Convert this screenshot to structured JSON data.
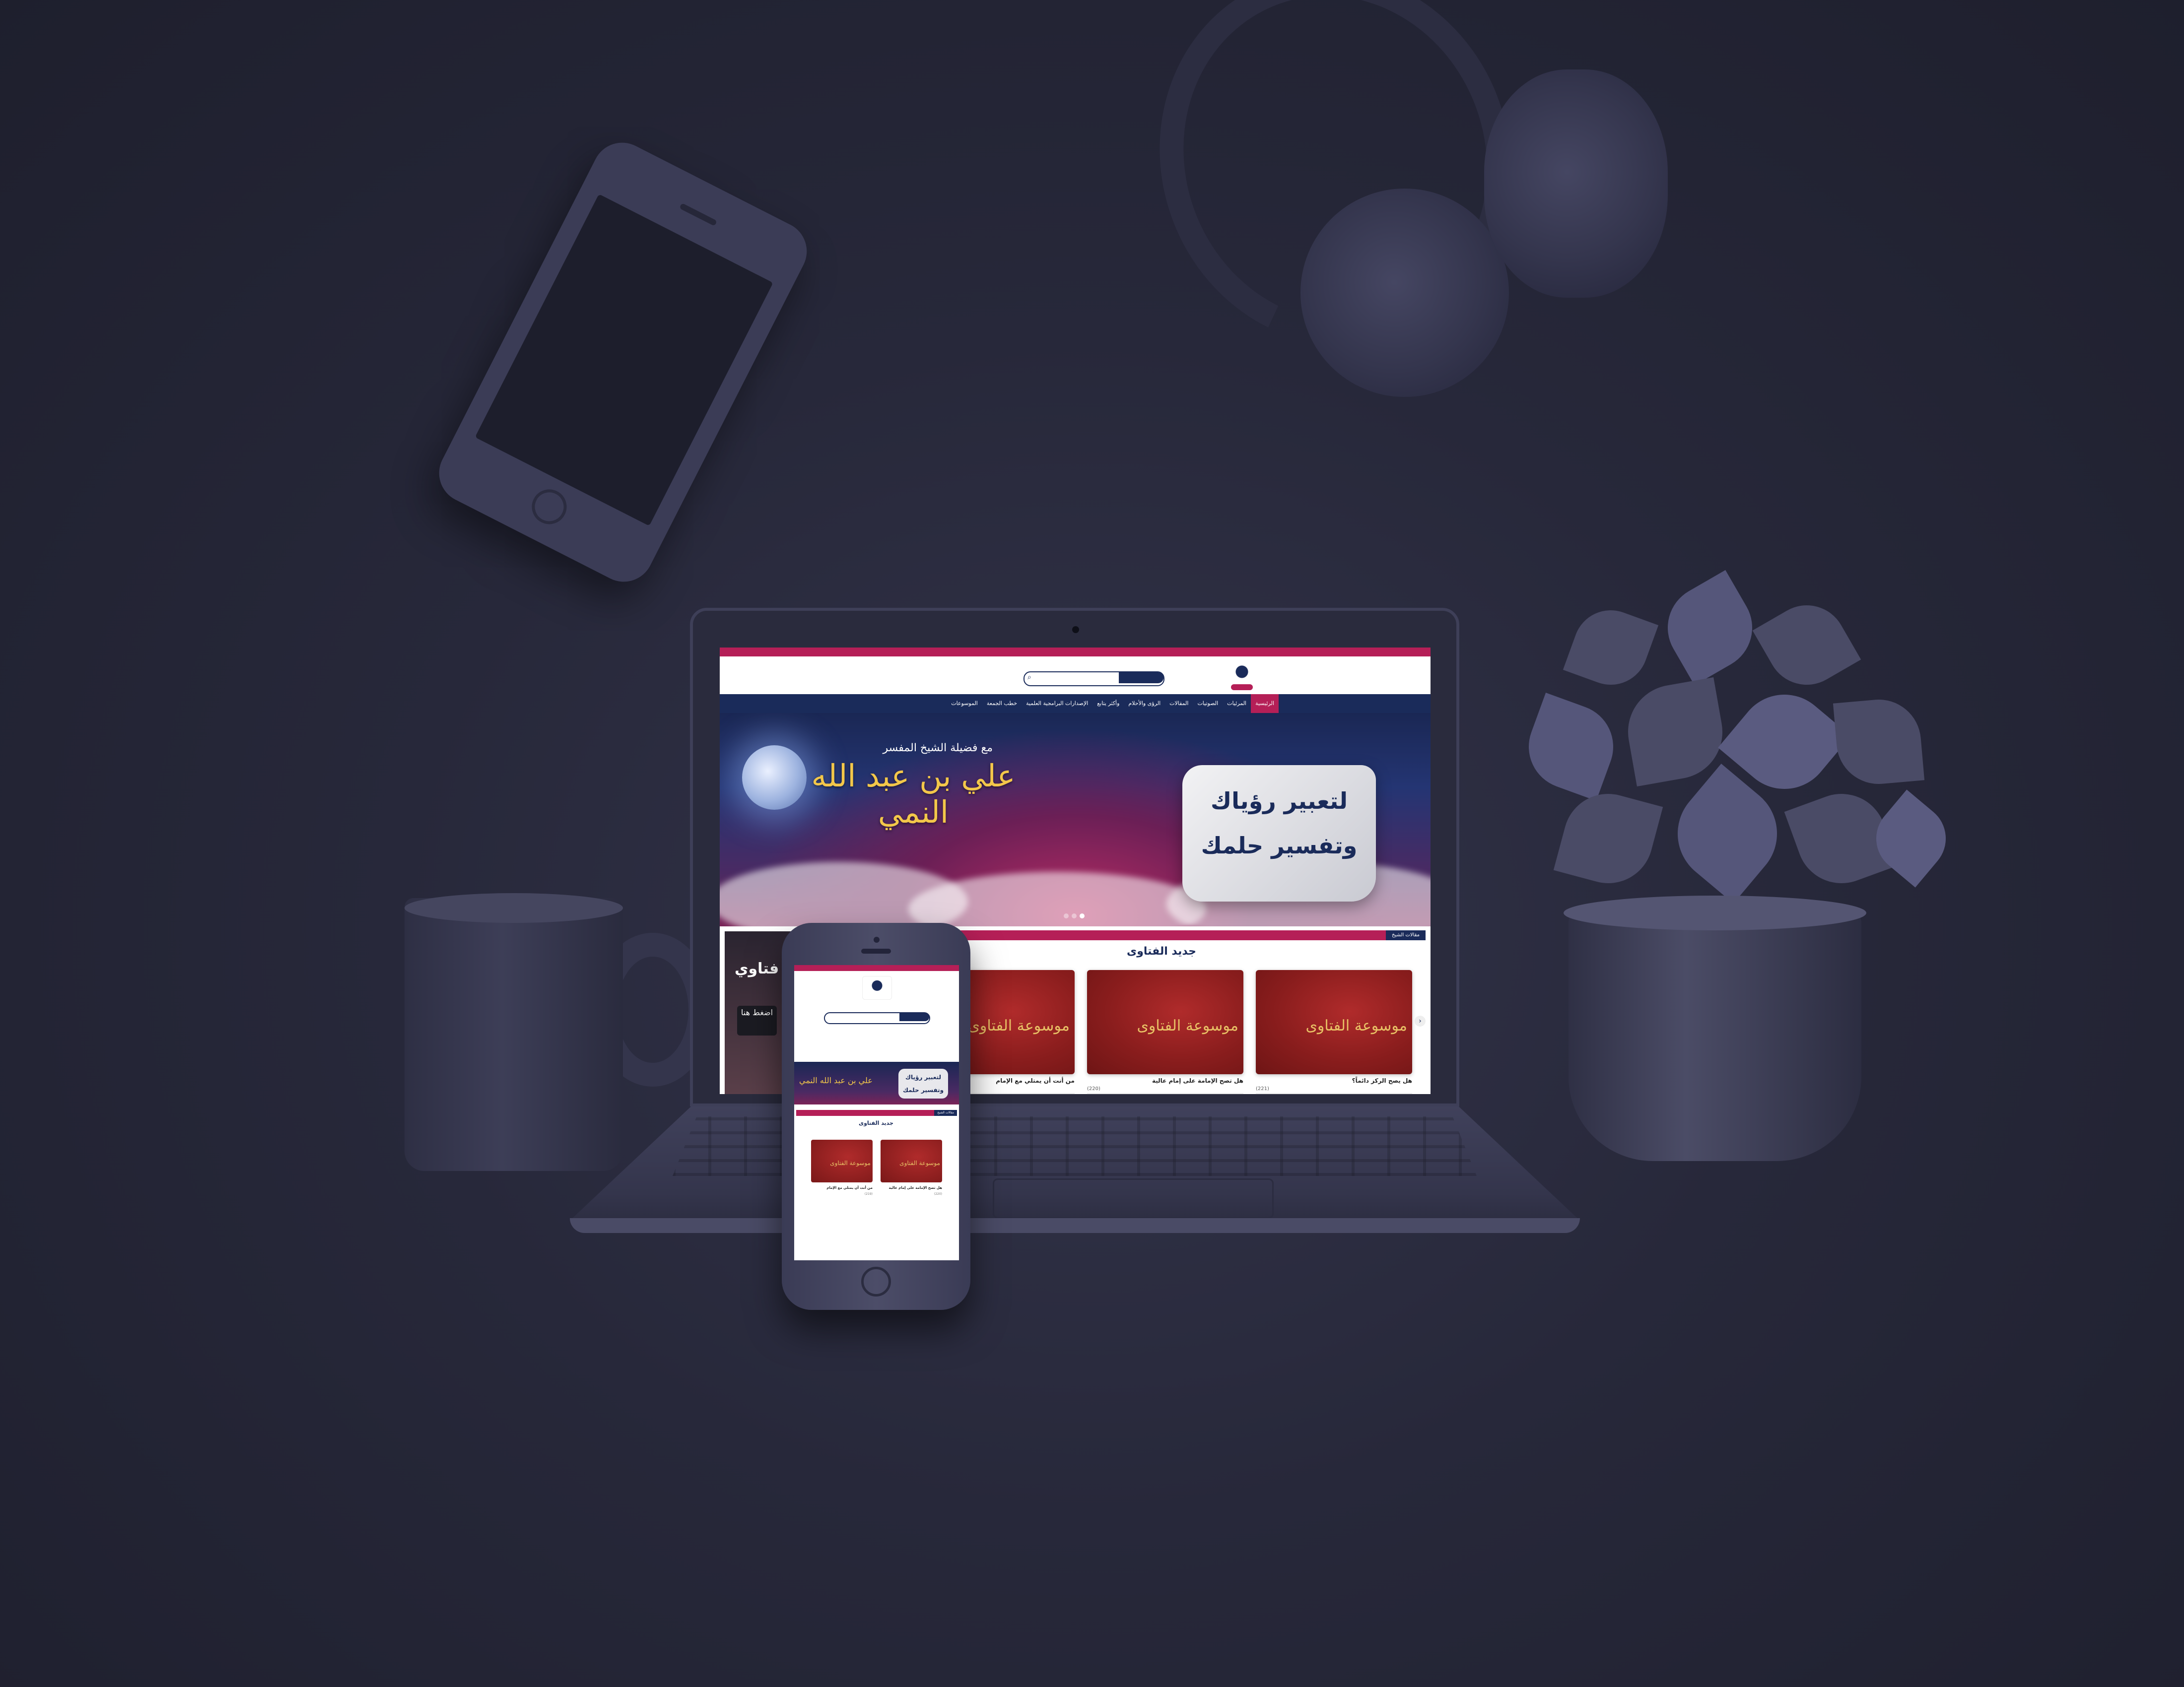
{
  "colors": {
    "background": "#27283a",
    "brand_red": "#b51f57",
    "brand_navy": "#1a2b5a",
    "gold": "#f3c74a"
  },
  "website": {
    "topbar": {
      "left_text": "",
      "right_text": ""
    },
    "search": {
      "button": "",
      "icon": "search-icon"
    },
    "nav": [
      {
        "label": "الرئيسية",
        "icon": "home-icon",
        "active": true
      },
      {
        "label": "المرئيات",
        "icon": "video-icon",
        "active": false
      },
      {
        "label": "الصوتيات",
        "icon": "audio-icon",
        "active": false
      },
      {
        "label": "المقالات",
        "icon": "article-icon",
        "active": false
      },
      {
        "label": "الرؤى والأحلام",
        "icon": "moon-icon",
        "active": false
      },
      {
        "label": "وأكثر يتابع",
        "icon": "megaphone-icon",
        "active": false
      },
      {
        "label": "الإصدارات البرامجية العلمية",
        "icon": "book-icon",
        "active": false
      },
      {
        "label": "خطب الجمعة",
        "icon": "mosque-icon",
        "active": false
      },
      {
        "label": "الموسوعات",
        "icon": "library-icon",
        "active": false
      }
    ],
    "hero": {
      "subtitle": "مع فضيلة الشيخ المفسر",
      "calligraphy": "علي بن عبد الله النمي",
      "pillow_line1": "لتعبير رؤياك",
      "pillow_line2": "وتفسير حلمك",
      "slides": 3,
      "active_slide": 2
    },
    "side_ad": {
      "text": "فتاوي",
      "button": "اضغط هنا"
    },
    "section": {
      "tag": "مقالات الشيخ",
      "title": "جديد الفتاوى"
    },
    "cards": [
      {
        "calligraphy": "موسوعة الفتاوى",
        "caption": "هل يصح الركز دائماً؟",
        "number": "(221)"
      },
      {
        "calligraphy": "موسوعة الفتاوى",
        "caption": "هل تصح الإمامة على إمام عالية",
        "number": "(220)"
      },
      {
        "calligraphy": "موسوعة الفتاوى",
        "caption": "من أنت أن يمتلي مع الإمام",
        "number": "(219)"
      }
    ]
  },
  "mobile": {
    "section": {
      "tag": "مقالات الشيخ",
      "title": "جديد الفتاوى"
    },
    "hero": {
      "pillow_line1": "لتعبير رؤياك",
      "pillow_line2": "وتفسير حلمك"
    },
    "cards": [
      {
        "calligraphy": "موسوعة الفتاوى",
        "caption": "هل تصح الإمامة على إمام عالية",
        "number": "(220)"
      },
      {
        "calligraphy": "موسوعة الفتاوى",
        "caption": "من أنت أن يمتلي مع الإمام",
        "number": "(219)"
      }
    ]
  }
}
